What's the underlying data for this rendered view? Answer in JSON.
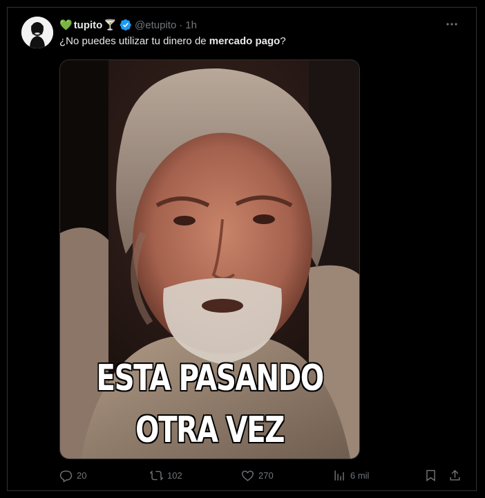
{
  "tweet": {
    "display_name": "tupito",
    "name_emoji_left": "💚",
    "name_emoji_right": "🍸",
    "handle": "@etupito",
    "separator": "·",
    "time": "1h",
    "text_before": "¿No puedes utilizar tu dinero de ",
    "text_bold": "mercado pago",
    "text_after": "?",
    "media": {
      "caption_line1": "ESTA PASANDO",
      "caption_line2": "OTRA VEZ"
    },
    "actions": {
      "replies": "20",
      "retweets": "102",
      "likes": "270",
      "views": "6 mil"
    }
  },
  "colors": {
    "background": "#000000",
    "text": "#e7e9ea",
    "secondary": "#71767b",
    "verified": "#1d9bf0",
    "border": "#2f3336"
  },
  "icons": [
    "more-icon",
    "verified-icon",
    "reply-icon",
    "retweet-icon",
    "like-icon",
    "views-icon",
    "bookmark-icon",
    "share-icon"
  ]
}
